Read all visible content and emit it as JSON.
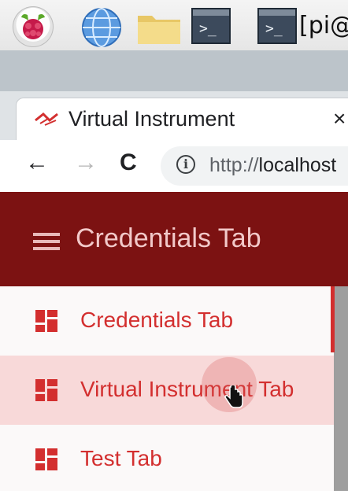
{
  "taskbar": {
    "launchers": [
      "raspberry-pi-menu-icon",
      "web-browser-icon",
      "file-manager-icon",
      "terminal-icon",
      "terminal-icon"
    ],
    "terminal_prompt": ">_",
    "window_title": "[pi@"
  },
  "browser": {
    "tab": {
      "title": "Virtual Instrument",
      "close": "×",
      "favicon": "tab-favicon-icon"
    },
    "nav": {
      "back": "←",
      "forward": "→",
      "reload": "C"
    },
    "address": {
      "info": "i",
      "scheme": "http://",
      "host": "localhost"
    }
  },
  "app": {
    "header_title": "Credentials Tab",
    "menu": [
      {
        "label": "Credentials Tab",
        "selected": false
      },
      {
        "label": "Virtual Instrument Tab",
        "selected": true
      },
      {
        "label": "Test Tab",
        "selected": false
      }
    ]
  },
  "colors": {
    "header_bg": "#7c1212",
    "accent": "#d32f2f",
    "selected_bg": "#f8d9d9"
  }
}
